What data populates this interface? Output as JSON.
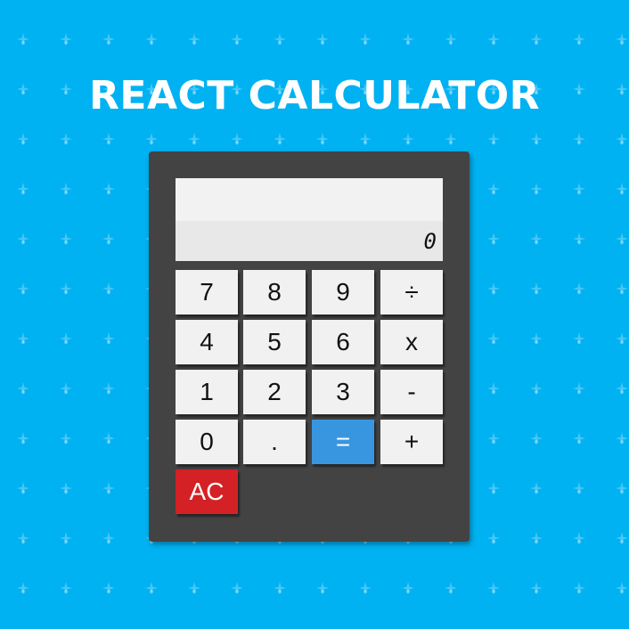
{
  "header": {
    "title": "REACT CALCULATOR"
  },
  "display": {
    "previous": "",
    "current": "0"
  },
  "keypad": {
    "seven": "7",
    "eight": "8",
    "nine": "9",
    "divide": "÷",
    "four": "4",
    "five": "5",
    "six": "6",
    "multiply": "x",
    "one": "1",
    "two": "2",
    "three": "3",
    "subtract": "-",
    "zero": "0",
    "decimal": ".",
    "equals": "=",
    "add": "+",
    "clear": "AC"
  },
  "colors": {
    "background": "#01b2f2",
    "calculator_body": "#434343",
    "equals_key": "#3896e0",
    "clear_key": "#d42126",
    "key": "#f1f1f1"
  }
}
